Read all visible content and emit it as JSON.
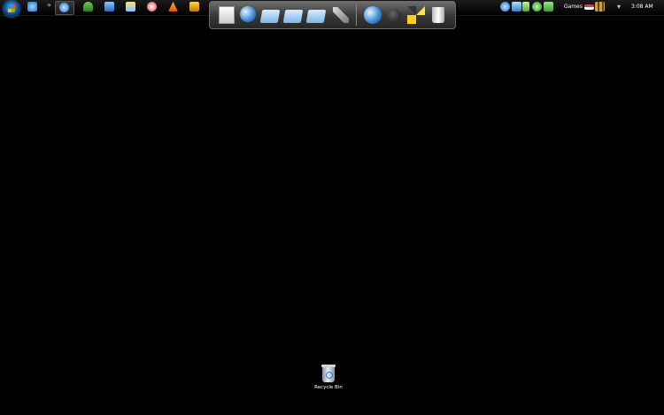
{
  "taskbar": {
    "clock": "3:08 AM",
    "tray_label": "Games",
    "quicklaunch_overflow": "»",
    "tray_overflow": "▾"
  },
  "dock": {
    "items": [
      "notepad-icon",
      "globe-doc-icon",
      "folder-icon",
      "folder-icon",
      "folder-icon",
      "tools-icon",
      "globe-icon",
      "bomb-icon",
      "pinwheel-icon",
      "recycle-bin-icon"
    ]
  },
  "desktop": {
    "recycle_bin_label": "Recycle Bin"
  },
  "colors": {
    "background": "#000000",
    "taskbar": "#111111",
    "dock": "#4a4a4a"
  }
}
